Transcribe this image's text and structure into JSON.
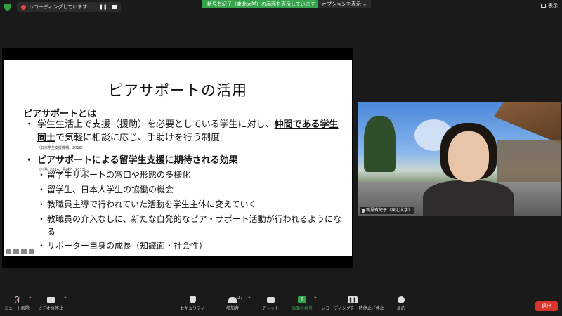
{
  "topbar": {
    "recording_label": "レコーディングしています...",
    "share_banner": "新見有紀子（東北大学）の画面を表示しています",
    "options_label": "オプションを表示",
    "view_label": "表示"
  },
  "slide": {
    "title": "ピアサポートの活用",
    "section1_heading": "ピアサポートとは",
    "bullet_dot": "・",
    "bullet1_pre": "学生生活上で支援（援助）を必要としている学生に対し、",
    "bullet1_underlined": "仲間である学生同士",
    "bullet1_post": "で気軽に相談に応じ、手助けを行う制度",
    "citation1": "（日本学生支援機構、2018）",
    "bullet2": "ピアサポートによる留学生支援に期待される効果",
    "citation2": "（八島, 2014、島越ら, 2013）",
    "sub_items": [
      "留学生サポートの窓口や形態の多様化",
      "留学生、日本人学生の協働の機会",
      "教職員主導で行われていた活動を学生主体に変えていく",
      "教職員の介入なしに、新たな自発的なピア・サポート活動が行われるようになる",
      "サポーター自身の成長（知識面・社会性）"
    ]
  },
  "video": {
    "participant_name": "新見有紀子（東北大学）"
  },
  "toolbar": {
    "mute_label": "ミュート解除",
    "video_label": "ビデオの停止",
    "security_label": "セキュリティ",
    "participants_label": "参加者",
    "participants_count": "27",
    "chat_label": "チャット",
    "share_label": "画面の共有",
    "recording_label": "レコーディングを一時停止／停止",
    "reactions_label": "反応",
    "end_label": "退出"
  },
  "colors": {
    "share_green": "#35a34a",
    "end_red": "#d9352b",
    "rec_red": "#e04848"
  }
}
